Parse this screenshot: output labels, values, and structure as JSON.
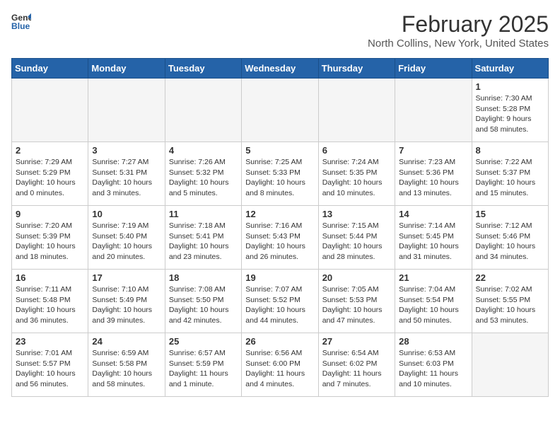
{
  "header": {
    "logo_line1": "General",
    "logo_line2": "Blue",
    "title": "February 2025",
    "subtitle": "North Collins, New York, United States"
  },
  "weekdays": [
    "Sunday",
    "Monday",
    "Tuesday",
    "Wednesday",
    "Thursday",
    "Friday",
    "Saturday"
  ],
  "weeks": [
    [
      {
        "num": "",
        "info": ""
      },
      {
        "num": "",
        "info": ""
      },
      {
        "num": "",
        "info": ""
      },
      {
        "num": "",
        "info": ""
      },
      {
        "num": "",
        "info": ""
      },
      {
        "num": "",
        "info": ""
      },
      {
        "num": "1",
        "info": "Sunrise: 7:30 AM\nSunset: 5:28 PM\nDaylight: 9 hours\nand 58 minutes."
      }
    ],
    [
      {
        "num": "2",
        "info": "Sunrise: 7:29 AM\nSunset: 5:29 PM\nDaylight: 10 hours\nand 0 minutes."
      },
      {
        "num": "3",
        "info": "Sunrise: 7:27 AM\nSunset: 5:31 PM\nDaylight: 10 hours\nand 3 minutes."
      },
      {
        "num": "4",
        "info": "Sunrise: 7:26 AM\nSunset: 5:32 PM\nDaylight: 10 hours\nand 5 minutes."
      },
      {
        "num": "5",
        "info": "Sunrise: 7:25 AM\nSunset: 5:33 PM\nDaylight: 10 hours\nand 8 minutes."
      },
      {
        "num": "6",
        "info": "Sunrise: 7:24 AM\nSunset: 5:35 PM\nDaylight: 10 hours\nand 10 minutes."
      },
      {
        "num": "7",
        "info": "Sunrise: 7:23 AM\nSunset: 5:36 PM\nDaylight: 10 hours\nand 13 minutes."
      },
      {
        "num": "8",
        "info": "Sunrise: 7:22 AM\nSunset: 5:37 PM\nDaylight: 10 hours\nand 15 minutes."
      }
    ],
    [
      {
        "num": "9",
        "info": "Sunrise: 7:20 AM\nSunset: 5:39 PM\nDaylight: 10 hours\nand 18 minutes."
      },
      {
        "num": "10",
        "info": "Sunrise: 7:19 AM\nSunset: 5:40 PM\nDaylight: 10 hours\nand 20 minutes."
      },
      {
        "num": "11",
        "info": "Sunrise: 7:18 AM\nSunset: 5:41 PM\nDaylight: 10 hours\nand 23 minutes."
      },
      {
        "num": "12",
        "info": "Sunrise: 7:16 AM\nSunset: 5:43 PM\nDaylight: 10 hours\nand 26 minutes."
      },
      {
        "num": "13",
        "info": "Sunrise: 7:15 AM\nSunset: 5:44 PM\nDaylight: 10 hours\nand 28 minutes."
      },
      {
        "num": "14",
        "info": "Sunrise: 7:14 AM\nSunset: 5:45 PM\nDaylight: 10 hours\nand 31 minutes."
      },
      {
        "num": "15",
        "info": "Sunrise: 7:12 AM\nSunset: 5:46 PM\nDaylight: 10 hours\nand 34 minutes."
      }
    ],
    [
      {
        "num": "16",
        "info": "Sunrise: 7:11 AM\nSunset: 5:48 PM\nDaylight: 10 hours\nand 36 minutes."
      },
      {
        "num": "17",
        "info": "Sunrise: 7:10 AM\nSunset: 5:49 PM\nDaylight: 10 hours\nand 39 minutes."
      },
      {
        "num": "18",
        "info": "Sunrise: 7:08 AM\nSunset: 5:50 PM\nDaylight: 10 hours\nand 42 minutes."
      },
      {
        "num": "19",
        "info": "Sunrise: 7:07 AM\nSunset: 5:52 PM\nDaylight: 10 hours\nand 44 minutes."
      },
      {
        "num": "20",
        "info": "Sunrise: 7:05 AM\nSunset: 5:53 PM\nDaylight: 10 hours\nand 47 minutes."
      },
      {
        "num": "21",
        "info": "Sunrise: 7:04 AM\nSunset: 5:54 PM\nDaylight: 10 hours\nand 50 minutes."
      },
      {
        "num": "22",
        "info": "Sunrise: 7:02 AM\nSunset: 5:55 PM\nDaylight: 10 hours\nand 53 minutes."
      }
    ],
    [
      {
        "num": "23",
        "info": "Sunrise: 7:01 AM\nSunset: 5:57 PM\nDaylight: 10 hours\nand 56 minutes."
      },
      {
        "num": "24",
        "info": "Sunrise: 6:59 AM\nSunset: 5:58 PM\nDaylight: 10 hours\nand 58 minutes."
      },
      {
        "num": "25",
        "info": "Sunrise: 6:57 AM\nSunset: 5:59 PM\nDaylight: 11 hours\nand 1 minute."
      },
      {
        "num": "26",
        "info": "Sunrise: 6:56 AM\nSunset: 6:00 PM\nDaylight: 11 hours\nand 4 minutes."
      },
      {
        "num": "27",
        "info": "Sunrise: 6:54 AM\nSunset: 6:02 PM\nDaylight: 11 hours\nand 7 minutes."
      },
      {
        "num": "28",
        "info": "Sunrise: 6:53 AM\nSunset: 6:03 PM\nDaylight: 11 hours\nand 10 minutes."
      },
      {
        "num": "",
        "info": ""
      }
    ]
  ]
}
